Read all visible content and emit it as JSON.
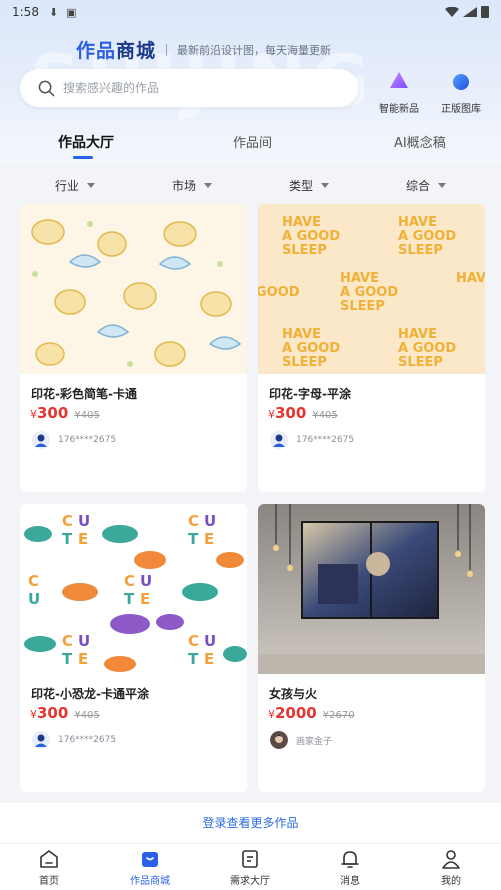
{
  "status_bar": {
    "time": "1:58"
  },
  "brand": {
    "title_a": "作品",
    "title_b": "商城",
    "subtitle": "最新前沿设计图，每天海量更新",
    "watermark": "SHIJING"
  },
  "search": {
    "placeholder": "搜索感兴趣的作品"
  },
  "quick_links": [
    {
      "label": "智能新品",
      "icon": "smart-new-icon"
    },
    {
      "label": "正版图库",
      "icon": "gallery-icon"
    }
  ],
  "tabs": [
    {
      "label": "作品大厅",
      "active": true
    },
    {
      "label": "作品间",
      "active": false
    },
    {
      "label": "AI概念稿",
      "active": false
    }
  ],
  "filters": [
    "行业",
    "市场",
    "类型",
    "综合"
  ],
  "products": [
    {
      "title": "印花-彩色简笔-卡通",
      "currency": "¥",
      "price": "300",
      "old_price": "405",
      "author": "176****2675"
    },
    {
      "title": "印花-字母-平涂",
      "currency": "¥",
      "price": "300",
      "old_price": "405",
      "author": "176****2675",
      "art_text": "HAVE A GOOD SLEEP"
    },
    {
      "title": "印花-小恐龙-卡通平涂",
      "currency": "¥",
      "price": "300",
      "old_price": "405",
      "author": "176****2675",
      "art_text": "CUTE"
    },
    {
      "title": "女孩与火",
      "currency": "¥",
      "price": "2000",
      "old_price": "2670",
      "author": "画家金子"
    }
  ],
  "more_link": "登录查看更多作品",
  "bottom_nav": [
    {
      "label": "首页",
      "icon": "home-icon",
      "active": false
    },
    {
      "label": "作品商城",
      "icon": "shop-icon",
      "active": true
    },
    {
      "label": "需求大厅",
      "icon": "demand-icon",
      "active": false
    },
    {
      "label": "消息",
      "icon": "bell-icon",
      "active": false
    },
    {
      "label": "我的",
      "icon": "profile-icon",
      "active": false
    }
  ],
  "colors": {
    "accent": "#2962e9",
    "price": "#e6342f",
    "brand": "#1d3a8a"
  }
}
